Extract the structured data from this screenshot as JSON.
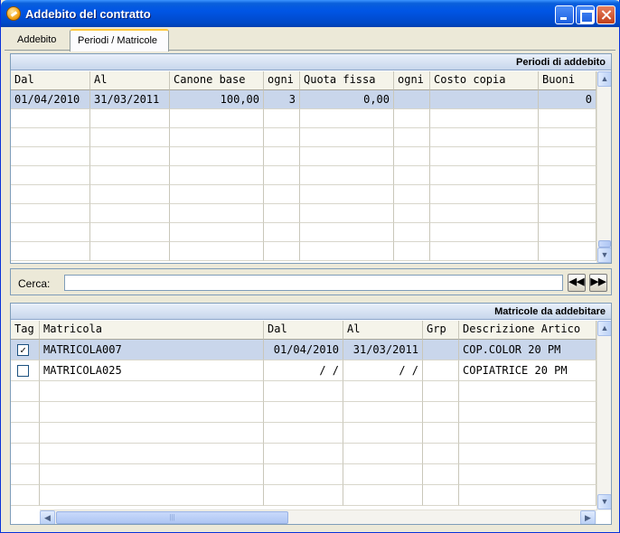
{
  "window": {
    "title": "Addebito del contratto"
  },
  "tabs": [
    {
      "label": "Addebito"
    },
    {
      "label": "Periodi / Matricole"
    }
  ],
  "periodi": {
    "title": "Periodi di addebito",
    "columns": [
      "Dal",
      "Al",
      "Canone base",
      "ogni",
      "Quota fissa",
      "ogni",
      "Costo copia",
      "Buoni"
    ],
    "rows": [
      [
        "01/04/2010",
        "31/03/2011",
        "100,00",
        "3",
        "0,00",
        "",
        "",
        "0"
      ]
    ]
  },
  "search": {
    "label": "Cerca:",
    "value": "",
    "prev_icon": "rewind-icon",
    "next_icon": "fast-forward-icon"
  },
  "matricole": {
    "title": "Matricole da addebitare",
    "columns": [
      "Tag",
      "Matricola",
      "Dal",
      "Al",
      "Grp",
      "Descrizione Artico"
    ],
    "rows": [
      {
        "tag": "☑",
        "matricola": "MATRICOLA007",
        "dal": "01/04/2010",
        "al": "31/03/2011",
        "grp": "",
        "descr": "COP.COLOR 20 PM"
      },
      {
        "tag": "☐",
        "matricola": "MATRICOLA025",
        "dal": "  /  /",
        "al": "  /  /",
        "grp": "",
        "descr": "COPIATRICE 20 PM"
      }
    ]
  },
  "colors": {
    "titlebar": "#0055E5",
    "selected_row": "#C9D6EB",
    "panel_header": "#C7D6EC"
  }
}
